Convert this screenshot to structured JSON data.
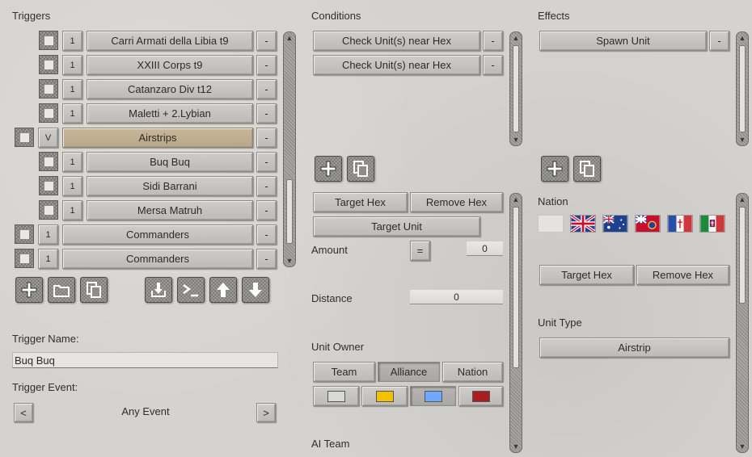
{
  "triggers": {
    "title": "Triggers",
    "rows": [
      {
        "num": "1",
        "label": "Carri Armati della Libia t9",
        "del": "-"
      },
      {
        "num": "1",
        "label": "XXIII Corps t9",
        "del": "-"
      },
      {
        "num": "1",
        "label": "Catanzaro Div t12",
        "del": "-"
      },
      {
        "num": "1",
        "label": "Maletti + 2.Lybian",
        "del": "-"
      },
      {
        "num": "V",
        "label": "Airstrips",
        "del": "-"
      },
      {
        "num": "1",
        "label": "Buq Buq",
        "del": "-"
      },
      {
        "num": "1",
        "label": "Sidi Barrani",
        "del": "-"
      },
      {
        "num": "1",
        "label": "Mersa Matruh",
        "del": "-"
      },
      {
        "num": "1",
        "label": "Commanders",
        "del": "-"
      },
      {
        "num": "1",
        "label": "Commanders",
        "del": "-"
      }
    ],
    "toolbar_icons": [
      "add-icon",
      "folder-icon",
      "copy-icon",
      "import-icon",
      "console-icon",
      "move-up-icon",
      "move-down-icon"
    ],
    "name_label": "Trigger Name:",
    "name_value": "Buq Buq",
    "event_label": "Trigger Event:",
    "event_prev": "<",
    "event_value": "Any Event",
    "event_next": ">"
  },
  "conditions": {
    "title": "Conditions",
    "rows": [
      {
        "label": "Check Unit(s) near Hex",
        "del": "-"
      },
      {
        "label": "Check Unit(s) near Hex",
        "del": "-"
      }
    ],
    "target_hex": "Target Hex",
    "remove_hex": "Remove Hex",
    "target_unit": "Target Unit",
    "amount_label": "Amount",
    "amount_op": "=",
    "amount_value": "0",
    "distance_label": "Distance",
    "distance_value": "0",
    "unit_owner_label": "Unit Owner",
    "owner_tabs": [
      "Team",
      "Alliance",
      "Nation"
    ],
    "owner_selected": "Alliance",
    "team_colors": [
      "#d8d8d8",
      "#f2c200",
      "#6fa8ff",
      "#a81e1e"
    ],
    "ai_team_label": "AI Team"
  },
  "effects": {
    "title": "Effects",
    "rows": [
      {
        "label": "Spawn Unit",
        "del": "-"
      }
    ],
    "nation_label": "Nation",
    "flags": [
      "blank",
      "uk",
      "australia",
      "india",
      "france",
      "italy"
    ],
    "target_hex": "Target Hex",
    "remove_hex": "Remove Hex",
    "unit_type_label": "Unit Type",
    "unit_type_value": "Airstrip"
  }
}
